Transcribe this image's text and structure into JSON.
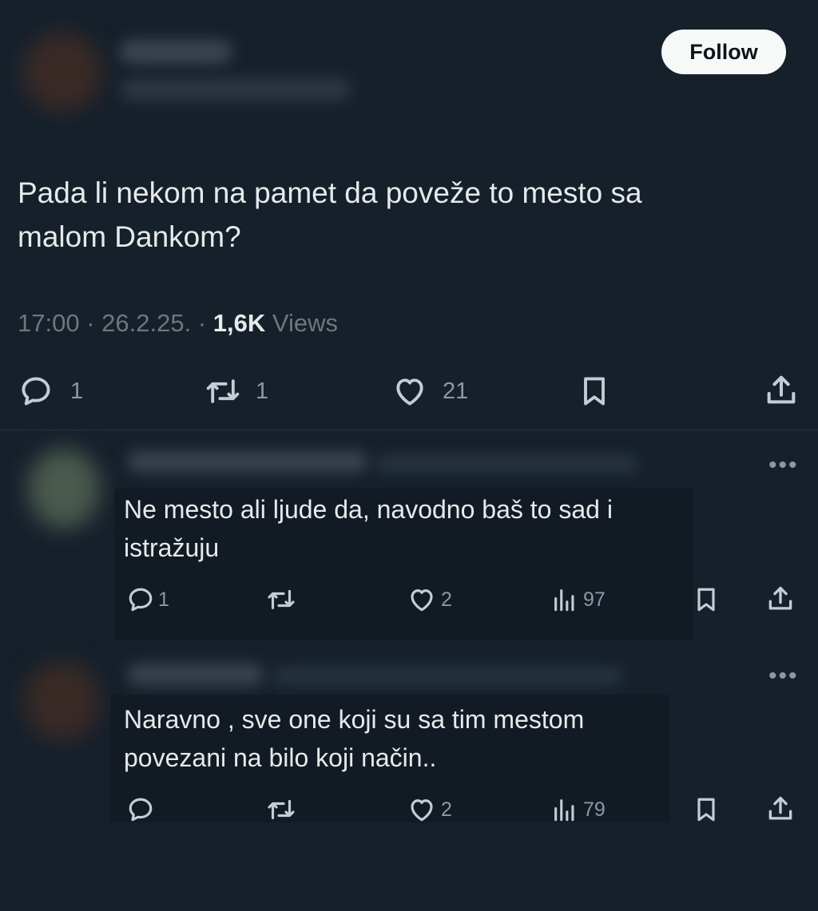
{
  "header": {
    "follow_label": "Follow"
  },
  "post": {
    "text_line1": "Pada li nekom na pamet da poveže to mesto sa",
    "text_line2": "malom Dankom?",
    "time": "17:00",
    "date": "26.2.25.",
    "views_count": "1,6K",
    "views_label": "Views",
    "actions": {
      "replies": "1",
      "reposts": "1",
      "likes": "21"
    }
  },
  "replies": [
    {
      "text_line1": "Ne mesto ali ljude da, navodno baš to sad i",
      "text_line2": "istražuju",
      "replies": "1",
      "likes": "2",
      "views": "97"
    },
    {
      "text_line1": "Naravno , sve one koji su sa tim mestom",
      "text_line2": "povezani na bilo koji način..",
      "likes": "2",
      "views": "79"
    }
  ],
  "colors": {
    "background": "#15202b",
    "text": "#e7e9ea",
    "muted": "#8b98a5"
  },
  "icons": [
    "reply-icon",
    "repost-icon",
    "like-icon",
    "bookmark-icon",
    "share-icon",
    "views-icon",
    "more-icon"
  ]
}
